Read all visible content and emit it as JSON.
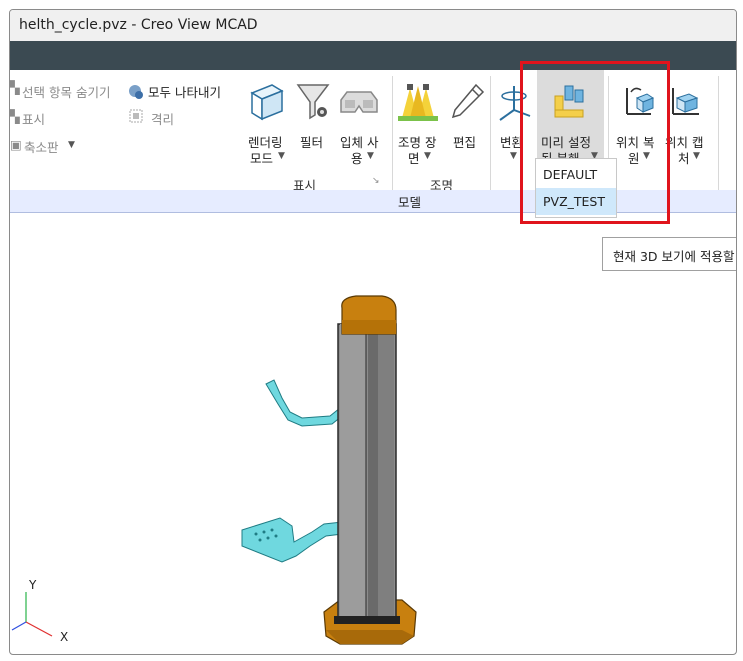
{
  "window": {
    "title": "helth_cycle.pvz - Creo View MCAD"
  },
  "ribbon": {
    "hide_selected": "선택 항목 숨기기",
    "show_all": "모두 나타내기",
    "show": "표시",
    "isolate": "격리",
    "minimap": "축소판",
    "render_mode": [
      "렌더링",
      "모드"
    ],
    "filter": "필터",
    "stereo": [
      "입체 사",
      "용"
    ],
    "light_scene": [
      "조명 장",
      "면"
    ],
    "edit": "편집",
    "transform": "변환",
    "preset_explode": [
      "미리 설정",
      "된 분해"
    ],
    "restore_position": [
      "위치 복",
      "원"
    ],
    "capture_position": [
      "위치 캡",
      "처"
    ],
    "group_display": "표시",
    "group_lighting": "조명",
    "tab_model": "모델"
  },
  "dropdown": {
    "items": [
      "DEFAULT",
      "PVZ_TEST"
    ],
    "selected": "PVZ_TEST"
  },
  "tooltip": {
    "text": "현재 3D 보기에 적용할"
  },
  "axes": {
    "y": "Y",
    "x": "X"
  },
  "colors": {
    "highlight_red": "#e0141c",
    "selection_blue": "#cfe8fb",
    "cap_orange": "#c8800f",
    "pipe_cyan": "#6fd8df"
  }
}
